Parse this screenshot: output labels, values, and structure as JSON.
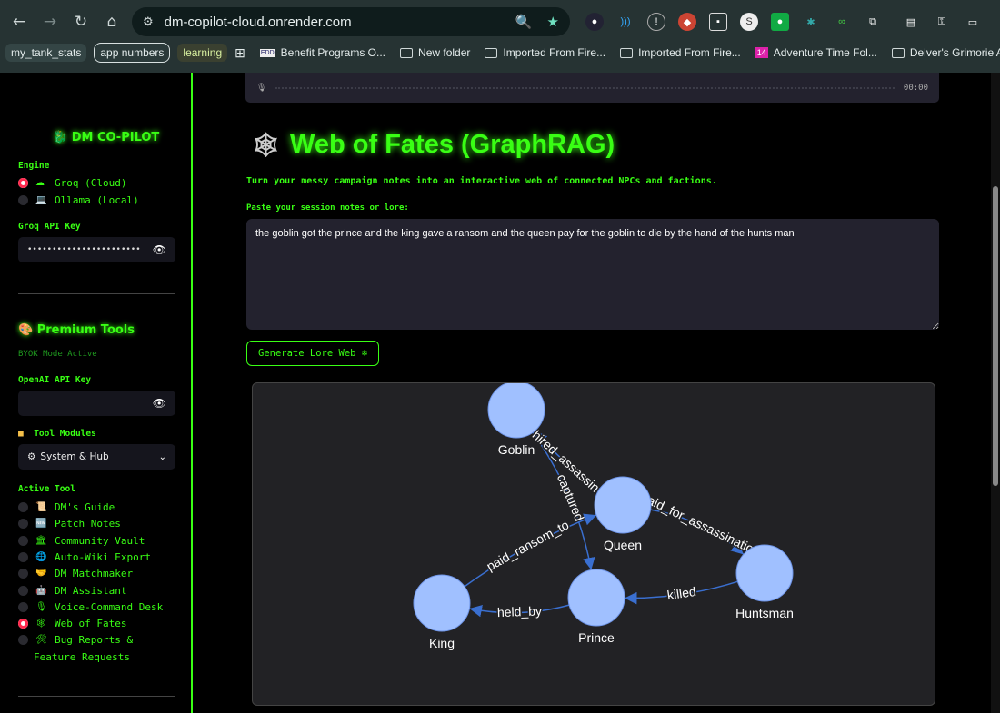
{
  "browser": {
    "url": "dm-copilot-cloud.onrender.com",
    "bookmarks": [
      "my_tank_stats",
      "app numbers",
      "learning",
      "Benefit Programs O...",
      "New folder",
      "Imported From Fire...",
      "Imported From Fire...",
      "Adventure Time Fol...",
      "Delver's Grimorie A"
    ]
  },
  "sidebar": {
    "brand": "DM CO-PILOT",
    "engine_label": "Engine",
    "engines": [
      {
        "label": "Groq (Cloud)",
        "icon": "☁",
        "selected": true
      },
      {
        "label": "Ollama (Local)",
        "icon": "💻",
        "selected": false
      }
    ],
    "groq_key_label": "Groq API Key",
    "groq_key_value": "••••••••••••••••••••••••••••••••••••••••",
    "premium_title": "Premium Tools",
    "byok": "BYOK Mode Active",
    "openai_key_label": "OpenAI API Key",
    "modules_label": "Tool Modules",
    "module_selected": "System & Hub",
    "active_tool_label": "Active Tool",
    "tools": [
      {
        "label": "DM's Guide",
        "icon": "📜"
      },
      {
        "label": "Patch Notes",
        "icon": "🆕"
      },
      {
        "label": "Community Vault",
        "icon": "🏛"
      },
      {
        "label": "Auto-Wiki Export",
        "icon": "🌐"
      },
      {
        "label": "DM Matchmaker",
        "icon": "🤝"
      },
      {
        "label": "DM Assistant",
        "icon": "🤖"
      },
      {
        "label": "Voice-Command Desk",
        "icon": "🎙"
      },
      {
        "label": "Web of Fates",
        "icon": "🕸",
        "selected": true
      },
      {
        "label": "Bug Reports &",
        "label2": "Feature Requests",
        "icon": "🛠"
      }
    ]
  },
  "main": {
    "audio_time": "00:00",
    "title": "Web of Fates (GraphRAG)",
    "subtitle": "Turn your messy campaign notes into an interactive web of connected NPCs and factions.",
    "notes_label": "Paste your session notes or lore:",
    "notes_value": "the goblin got the prince and the king gave a ransom and the queen pay for the goblin to die by the hand of the hunts man",
    "generate_label": "Generate Lore Web ❄"
  },
  "graph": {
    "node_color": "#a0c0ff",
    "edge_color": "#3a6fd0",
    "nodes": [
      "Goblin",
      "Queen",
      "Huntsman",
      "Prince",
      "King"
    ],
    "edges": [
      {
        "from": "Goblin",
        "to": "Prince",
        "label": "captured"
      },
      {
        "from": "Queen",
        "to": "Goblin",
        "label": "hired_assassin"
      },
      {
        "from": "Queen",
        "to": "Huntsman",
        "label": "paid_for_assassination"
      },
      {
        "from": "Huntsman",
        "to": "Prince",
        "label": "killed"
      },
      {
        "from": "King",
        "to": "Queen",
        "label": "paid_ransom_to"
      },
      {
        "from": "Prince",
        "to": "King",
        "label": "held_by"
      }
    ]
  }
}
